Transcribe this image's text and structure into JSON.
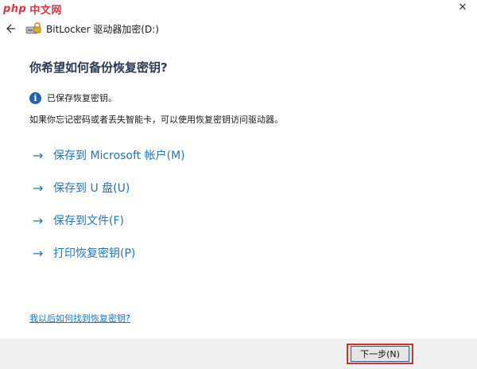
{
  "watermark": {
    "brand": "php",
    "text": "中文网"
  },
  "window": {
    "title": "BitLocker 驱动器加密(D:)",
    "close_glyph": "✕",
    "back_icon": "back-arrow-icon",
    "drive_icon": "bitlocker-drive-icon"
  },
  "main": {
    "heading": "你希望如何备份恢复密钥?",
    "info": {
      "icon": "info-icon",
      "icon_glyph": "i",
      "text": "已保存恢复密钥。"
    },
    "description": "如果你忘记密码或者丢失智能卡，可以使用恢复密钥访问驱动器。",
    "options": [
      {
        "arrow": "→",
        "label": "保存到 Microsoft 帐户(M)"
      },
      {
        "arrow": "→",
        "label": "保存到 U 盘(U)"
      },
      {
        "arrow": "→",
        "label": "保存到文件(F)"
      },
      {
        "arrow": "→",
        "label": "打印恢复密钥(P)"
      }
    ],
    "help_link": "我以后如何找到恢复密钥?"
  },
  "footer": {
    "next_label": "下一步(N)"
  },
  "colors": {
    "link": "#1e75c8",
    "info": "#1e62b4",
    "footer_bg": "#f0f0f0",
    "highlight": "#c0392b"
  }
}
